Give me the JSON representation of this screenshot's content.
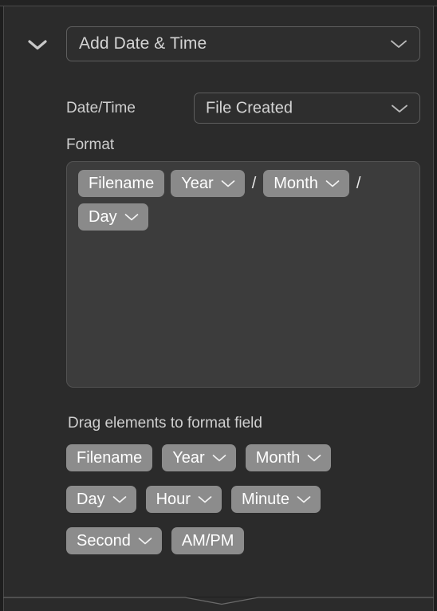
{
  "panel": {
    "collapse_icon": "chevron-down-icon",
    "action": {
      "label": "Add Date & Time",
      "caret_icon": "chevron-down-icon"
    },
    "datetime": {
      "label": "Date/Time",
      "value": "File Created",
      "caret_icon": "chevron-down-icon"
    },
    "format": {
      "label": "Format",
      "tokens": [
        {
          "label": "Filename",
          "has_caret": false
        },
        {
          "label": "Year",
          "has_caret": true
        },
        {
          "label": "/",
          "is_separator": true
        },
        {
          "label": "Month",
          "has_caret": true
        },
        {
          "label": "/",
          "is_separator": true
        },
        {
          "label": "Day",
          "has_caret": true
        }
      ]
    },
    "palette": {
      "hint": "Drag elements to format field",
      "rows": [
        [
          {
            "label": "Filename",
            "has_caret": false
          },
          {
            "label": "Year",
            "has_caret": true
          },
          {
            "label": "Month",
            "has_caret": true
          }
        ],
        [
          {
            "label": "Day",
            "has_caret": true
          },
          {
            "label": "Hour",
            "has_caret": true
          },
          {
            "label": "Minute",
            "has_caret": true
          }
        ],
        [
          {
            "label": "Second",
            "has_caret": true
          },
          {
            "label": "AM/PM",
            "has_caret": false
          }
        ]
      ]
    }
  },
  "colors": {
    "panel_bg": "#2b2b2b",
    "field_bg": "#3c3c3c",
    "chip_bg": "#8c8c8c",
    "border": "#4a4a4a",
    "text": "#d4d4d4",
    "chip_text": "#ffffff"
  }
}
